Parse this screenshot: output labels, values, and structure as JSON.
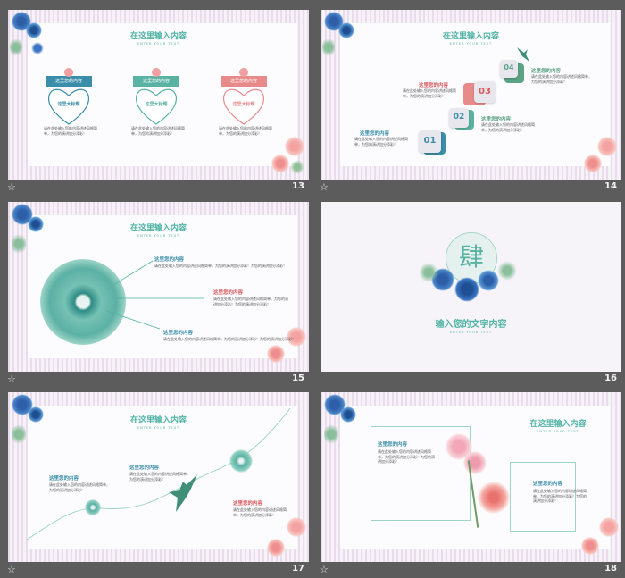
{
  "slides": [
    {
      "number": "13",
      "title": "在这里输入内容",
      "subtitle": "ENTER YOUR TEXT",
      "cards": [
        {
          "ribbon": "这里您的内容",
          "heart": "这里大标题",
          "body": "请在此处输入您的内容讲述风格简单，为您的演讲加分添彩！"
        },
        {
          "ribbon": "这里您的内容",
          "heart": "这里大标题",
          "body": "请在此处输入您的内容讲述风格简单，为您的演讲加分添彩！"
        },
        {
          "ribbon": "这里您的内容",
          "heart": "这里大标题",
          "body": "请在此处输入您的内容讲述风格简单，为您的演讲加分添彩！"
        }
      ]
    },
    {
      "number": "14",
      "title": "在这里输入内容",
      "subtitle": "ENTER YOUR TEXT",
      "steps": [
        {
          "label": "01",
          "heading": "这里您的内容",
          "body": "请在此处输入您的内容讲述风格简单，为您的演讲加分添彩！"
        },
        {
          "label": "02",
          "heading": "这里您的内容",
          "body": "请在此处输入您的内容讲述风格简单，为您的演讲加分添彩！"
        },
        {
          "label": "03",
          "heading": "这里您的内容",
          "body": "请在此处输入您的内容讲述风格简单，为您的演讲加分添彩！"
        },
        {
          "label": "04",
          "heading": "这里您的内容",
          "body": "请在此处输入您的内容讲述风格简单，为您的演讲加分添彩！"
        }
      ]
    },
    {
      "number": "15",
      "title": "在这里输入内容",
      "subtitle": "ENTER YOUR TEXT",
      "items": [
        {
          "heading": "这里您的内容",
          "body": "请在此处输入您的内容讲述风格简单，为您的演讲加分添彩！为您的演讲加分添彩！"
        },
        {
          "heading": "这里您的内容",
          "body": "请在此处输入您的内容讲述风格简单，为您的演讲加分添彩！为您的演讲加分添彩！"
        },
        {
          "heading": "这里您的内容",
          "body": "请在此处输入您的内容讲述风格简单，为您的演讲加分添彩！为您的演讲加分添彩！"
        }
      ]
    },
    {
      "number": "16",
      "glyph": "肆",
      "title": "输入您的文字内容",
      "subtitle": "ENTER YOUR TEXT"
    },
    {
      "number": "17",
      "title": "在这里输入内容",
      "subtitle": "ENTER YOUR TEXT",
      "items": [
        {
          "heading": "这里您的内容",
          "body": "请在此处输入您的内容讲述风格简单，为您的演讲加分添彩！"
        },
        {
          "heading": "这里您的内容",
          "body": "请在此处输入您的内容讲述风格简单，为您的演讲加分添彩！"
        },
        {
          "heading": "这里您的内容",
          "body": "请在此处输入您的内容讲述风格简单，为您的演讲加分添彩！"
        }
      ]
    },
    {
      "number": "18",
      "title": "在这里输入内容",
      "subtitle": "ENTER YOUR TEXT",
      "items": [
        {
          "heading": "这里您的内容",
          "body": "请在此处输入您的内容讲述风格简单，为您的演讲加分添彩！为您的演讲加分添彩！"
        },
        {
          "heading": "这里您的内容",
          "body": "请在此处输入您的内容讲述风格简单，为您的演讲加分添彩！为您的演讲加分添彩！"
        }
      ]
    }
  ],
  "colors": {
    "teal": "#4fb3a4",
    "red": "#d9595e",
    "blue": "#3a8ea9",
    "pink": "#e88a8a",
    "green": "#5aa384",
    "background": "#5c5c5c"
  },
  "icons": {
    "slide-star": "star-icon"
  }
}
